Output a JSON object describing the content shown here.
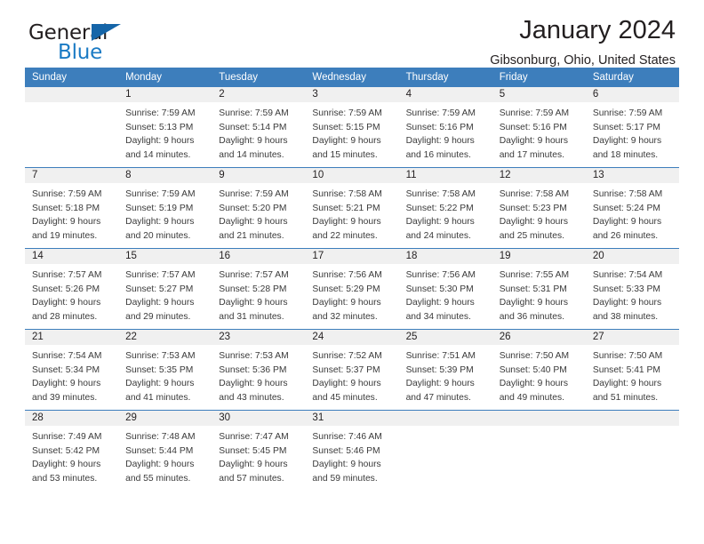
{
  "brand": {
    "name_top": "General",
    "name_bottom": "Blue",
    "flag_color": "#1565a8",
    "bottom_color": "#1a7ac4"
  },
  "header": {
    "title": "January 2024",
    "subtitle": "Gibsonburg, Ohio, United States"
  },
  "theme": {
    "header_bg": "#3d7ebc",
    "daynum_bg": "#f0f0f0",
    "text": "#231f20"
  },
  "weekday_headers": [
    "Sunday",
    "Monday",
    "Tuesday",
    "Wednesday",
    "Thursday",
    "Friday",
    "Saturday"
  ],
  "weeks": [
    [
      {
        "day": "",
        "empty": true,
        "sunrise": "",
        "sunset": "",
        "daylight1": "",
        "daylight2": ""
      },
      {
        "day": "1",
        "sunrise": "Sunrise: 7:59 AM",
        "sunset": "Sunset: 5:13 PM",
        "daylight1": "Daylight: 9 hours",
        "daylight2": "and 14 minutes."
      },
      {
        "day": "2",
        "sunrise": "Sunrise: 7:59 AM",
        "sunset": "Sunset: 5:14 PM",
        "daylight1": "Daylight: 9 hours",
        "daylight2": "and 14 minutes."
      },
      {
        "day": "3",
        "sunrise": "Sunrise: 7:59 AM",
        "sunset": "Sunset: 5:15 PM",
        "daylight1": "Daylight: 9 hours",
        "daylight2": "and 15 minutes."
      },
      {
        "day": "4",
        "sunrise": "Sunrise: 7:59 AM",
        "sunset": "Sunset: 5:16 PM",
        "daylight1": "Daylight: 9 hours",
        "daylight2": "and 16 minutes."
      },
      {
        "day": "5",
        "sunrise": "Sunrise: 7:59 AM",
        "sunset": "Sunset: 5:16 PM",
        "daylight1": "Daylight: 9 hours",
        "daylight2": "and 17 minutes."
      },
      {
        "day": "6",
        "sunrise": "Sunrise: 7:59 AM",
        "sunset": "Sunset: 5:17 PM",
        "daylight1": "Daylight: 9 hours",
        "daylight2": "and 18 minutes."
      }
    ],
    [
      {
        "day": "7",
        "sunrise": "Sunrise: 7:59 AM",
        "sunset": "Sunset: 5:18 PM",
        "daylight1": "Daylight: 9 hours",
        "daylight2": "and 19 minutes."
      },
      {
        "day": "8",
        "sunrise": "Sunrise: 7:59 AM",
        "sunset": "Sunset: 5:19 PM",
        "daylight1": "Daylight: 9 hours",
        "daylight2": "and 20 minutes."
      },
      {
        "day": "9",
        "sunrise": "Sunrise: 7:59 AM",
        "sunset": "Sunset: 5:20 PM",
        "daylight1": "Daylight: 9 hours",
        "daylight2": "and 21 minutes."
      },
      {
        "day": "10",
        "sunrise": "Sunrise: 7:58 AM",
        "sunset": "Sunset: 5:21 PM",
        "daylight1": "Daylight: 9 hours",
        "daylight2": "and 22 minutes."
      },
      {
        "day": "11",
        "sunrise": "Sunrise: 7:58 AM",
        "sunset": "Sunset: 5:22 PM",
        "daylight1": "Daylight: 9 hours",
        "daylight2": "and 24 minutes."
      },
      {
        "day": "12",
        "sunrise": "Sunrise: 7:58 AM",
        "sunset": "Sunset: 5:23 PM",
        "daylight1": "Daylight: 9 hours",
        "daylight2": "and 25 minutes."
      },
      {
        "day": "13",
        "sunrise": "Sunrise: 7:58 AM",
        "sunset": "Sunset: 5:24 PM",
        "daylight1": "Daylight: 9 hours",
        "daylight2": "and 26 minutes."
      }
    ],
    [
      {
        "day": "14",
        "sunrise": "Sunrise: 7:57 AM",
        "sunset": "Sunset: 5:26 PM",
        "daylight1": "Daylight: 9 hours",
        "daylight2": "and 28 minutes."
      },
      {
        "day": "15",
        "sunrise": "Sunrise: 7:57 AM",
        "sunset": "Sunset: 5:27 PM",
        "daylight1": "Daylight: 9 hours",
        "daylight2": "and 29 minutes."
      },
      {
        "day": "16",
        "sunrise": "Sunrise: 7:57 AM",
        "sunset": "Sunset: 5:28 PM",
        "daylight1": "Daylight: 9 hours",
        "daylight2": "and 31 minutes."
      },
      {
        "day": "17",
        "sunrise": "Sunrise: 7:56 AM",
        "sunset": "Sunset: 5:29 PM",
        "daylight1": "Daylight: 9 hours",
        "daylight2": "and 32 minutes."
      },
      {
        "day": "18",
        "sunrise": "Sunrise: 7:56 AM",
        "sunset": "Sunset: 5:30 PM",
        "daylight1": "Daylight: 9 hours",
        "daylight2": "and 34 minutes."
      },
      {
        "day": "19",
        "sunrise": "Sunrise: 7:55 AM",
        "sunset": "Sunset: 5:31 PM",
        "daylight1": "Daylight: 9 hours",
        "daylight2": "and 36 minutes."
      },
      {
        "day": "20",
        "sunrise": "Sunrise: 7:54 AM",
        "sunset": "Sunset: 5:33 PM",
        "daylight1": "Daylight: 9 hours",
        "daylight2": "and 38 minutes."
      }
    ],
    [
      {
        "day": "21",
        "sunrise": "Sunrise: 7:54 AM",
        "sunset": "Sunset: 5:34 PM",
        "daylight1": "Daylight: 9 hours",
        "daylight2": "and 39 minutes."
      },
      {
        "day": "22",
        "sunrise": "Sunrise: 7:53 AM",
        "sunset": "Sunset: 5:35 PM",
        "daylight1": "Daylight: 9 hours",
        "daylight2": "and 41 minutes."
      },
      {
        "day": "23",
        "sunrise": "Sunrise: 7:53 AM",
        "sunset": "Sunset: 5:36 PM",
        "daylight1": "Daylight: 9 hours",
        "daylight2": "and 43 minutes."
      },
      {
        "day": "24",
        "sunrise": "Sunrise: 7:52 AM",
        "sunset": "Sunset: 5:37 PM",
        "daylight1": "Daylight: 9 hours",
        "daylight2": "and 45 minutes."
      },
      {
        "day": "25",
        "sunrise": "Sunrise: 7:51 AM",
        "sunset": "Sunset: 5:39 PM",
        "daylight1": "Daylight: 9 hours",
        "daylight2": "and 47 minutes."
      },
      {
        "day": "26",
        "sunrise": "Sunrise: 7:50 AM",
        "sunset": "Sunset: 5:40 PM",
        "daylight1": "Daylight: 9 hours",
        "daylight2": "and 49 minutes."
      },
      {
        "day": "27",
        "sunrise": "Sunrise: 7:50 AM",
        "sunset": "Sunset: 5:41 PM",
        "daylight1": "Daylight: 9 hours",
        "daylight2": "and 51 minutes."
      }
    ],
    [
      {
        "day": "28",
        "sunrise": "Sunrise: 7:49 AM",
        "sunset": "Sunset: 5:42 PM",
        "daylight1": "Daylight: 9 hours",
        "daylight2": "and 53 minutes."
      },
      {
        "day": "29",
        "sunrise": "Sunrise: 7:48 AM",
        "sunset": "Sunset: 5:44 PM",
        "daylight1": "Daylight: 9 hours",
        "daylight2": "and 55 minutes."
      },
      {
        "day": "30",
        "sunrise": "Sunrise: 7:47 AM",
        "sunset": "Sunset: 5:45 PM",
        "daylight1": "Daylight: 9 hours",
        "daylight2": "and 57 minutes."
      },
      {
        "day": "31",
        "sunrise": "Sunrise: 7:46 AM",
        "sunset": "Sunset: 5:46 PM",
        "daylight1": "Daylight: 9 hours",
        "daylight2": "and 59 minutes."
      },
      {
        "day": "",
        "empty": true,
        "sunrise": "",
        "sunset": "",
        "daylight1": "",
        "daylight2": ""
      },
      {
        "day": "",
        "empty": true,
        "sunrise": "",
        "sunset": "",
        "daylight1": "",
        "daylight2": ""
      },
      {
        "day": "",
        "empty": true,
        "sunrise": "",
        "sunset": "",
        "daylight1": "",
        "daylight2": ""
      }
    ]
  ]
}
